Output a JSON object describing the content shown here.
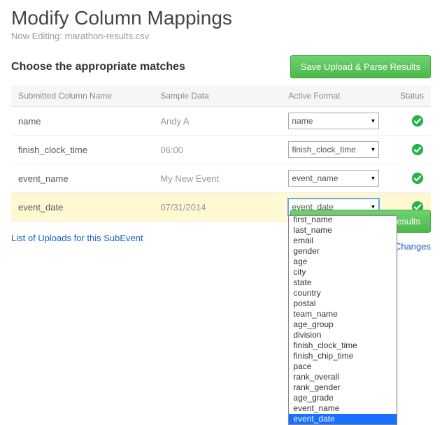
{
  "page_title": "Modify Column Mappings",
  "subtitle_prefix": "Now Editing: ",
  "filename": "marathon-results.csv",
  "section_title": "Choose the appropriate matches",
  "save_button": "Save Upload & Parse Results",
  "save_button_2": "Save Upload & Parse Results",
  "discard_link": "Discard Unsaved Changes",
  "uploads_link": "List of Uploads for this SubEvent",
  "table": {
    "headers": {
      "submitted": "Submitted Column Name",
      "sample": "Sample Data",
      "format": "Active Format",
      "status": "Status"
    },
    "rows": [
      {
        "submitted": "name",
        "sample": "Andy A",
        "format": "name",
        "highlight": false
      },
      {
        "submitted": "finish_clock_time",
        "sample": "06:00",
        "format": "finish_clock_time",
        "highlight": false
      },
      {
        "submitted": "event_name",
        "sample": "My New Event",
        "format": "event_name",
        "highlight": false
      },
      {
        "submitted": "event_date",
        "sample": "07/31/2014",
        "format": "event_date",
        "highlight": true
      }
    ]
  },
  "dropdown": {
    "selected": "event_date",
    "options": [
      "first_name",
      "last_name",
      "email",
      "gender",
      "age",
      "city",
      "state",
      "country",
      "postal",
      "team_name",
      "age_group",
      "division",
      "finish_clock_time",
      "finish_chip_time",
      "pace",
      "rank_overall",
      "rank_gender",
      "age_grade",
      "event_name",
      "event_date"
    ]
  }
}
